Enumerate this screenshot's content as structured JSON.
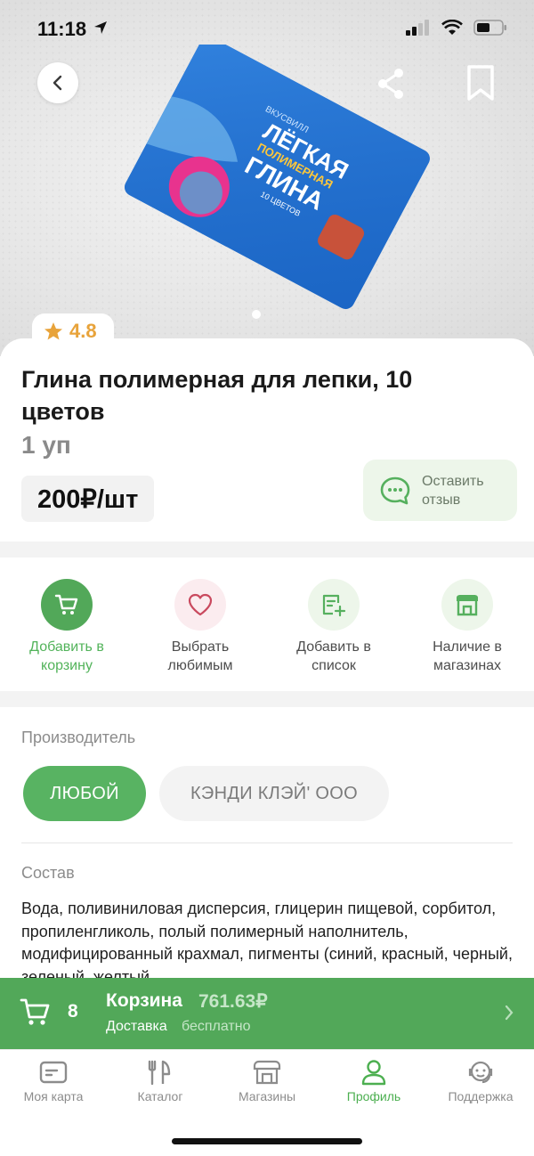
{
  "status_bar": {
    "time": "11:18"
  },
  "product": {
    "rating": "4.8",
    "title": "Глина полимерная для лепки, 10 цветов",
    "unit": "1 уп",
    "price": "200₽/шт",
    "review_button": "Оставить отзыв",
    "packaging_text": {
      "brand": "ВКУСВИЛЛ",
      "line1": "ЛЁГКАЯ",
      "line2": "ПОЛИМЕРНАЯ",
      "line3": "ГЛИНА",
      "count": "10 ЦВЕТОВ"
    },
    "image_pages": 1,
    "image_current_page": 1
  },
  "actions": [
    {
      "label": "Добавить в корзину",
      "icon": "cart-icon",
      "state": "active"
    },
    {
      "label": "Выбрать любимым",
      "icon": "heart-icon"
    },
    {
      "label": "Добавить в список",
      "icon": "list-add-icon"
    },
    {
      "label": "Наличие в магазинах",
      "icon": "store-icon"
    }
  ],
  "manufacturer": {
    "label": "Производитель",
    "options": [
      {
        "label": "ЛЮБОЙ",
        "selected": true
      },
      {
        "label": "КЭНДИ КЛЭЙ' ООО",
        "selected": false
      }
    ]
  },
  "composition": {
    "label": "Состав",
    "text": "Вода, поливиниловая дисперсия, глицерин пищевой, сорбитол, пропиленгликоль, полый полимерный наполнитель, модифицированный крахмал, пигменты (синий, красный, черный, зеленый, желтый,"
  },
  "cart": {
    "count": "8",
    "title": "Корзина",
    "total": "761.63₽",
    "delivery_label": "Доставка",
    "delivery_value": "бесплатно"
  },
  "tabs": [
    {
      "label": "Моя карта",
      "icon": "card-icon"
    },
    {
      "label": "Каталог",
      "icon": "catalog-icon"
    },
    {
      "label": "Магазины",
      "icon": "shops-icon"
    },
    {
      "label": "Профиль",
      "icon": "profile-icon",
      "active": true
    },
    {
      "label": "Поддержка",
      "icon": "support-icon"
    }
  ],
  "colors": {
    "accent": "#52A859",
    "rating": "#E8A33A",
    "review_bg": "#EDF6EA"
  }
}
